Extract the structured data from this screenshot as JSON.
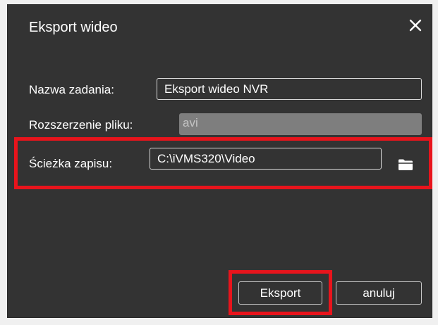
{
  "dialog": {
    "title": "Eksport wideo",
    "close_icon": "close-icon"
  },
  "form": {
    "task_name_label": "Nazwa zadania:",
    "task_name_value": "Eksport wideo NVR",
    "extension_label": "Rozszerzenie pliku:",
    "extension_value": "avi",
    "path_label": "Ścieżka zapisu:",
    "path_value": "C:\\iVMS320\\Video",
    "browse_icon": "folder-icon"
  },
  "buttons": {
    "export_label": "Eksport",
    "cancel_label": "anuluj"
  },
  "colors": {
    "dialog_background": "#333333",
    "highlight": "#e8141c",
    "disabled_field": "#7e7e7e"
  }
}
